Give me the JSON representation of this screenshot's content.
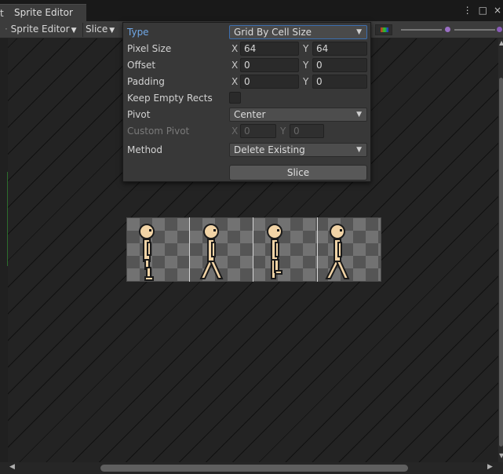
{
  "window": {
    "tab_clip_char": "t",
    "tab_title": "Sprite Editor",
    "controls": [
      "⋮",
      "□",
      "×"
    ]
  },
  "toolbar": {
    "editor_mode": "Sprite Editor",
    "slice_menu": "Slice"
  },
  "slice_popup": {
    "type_label": "Type",
    "type_value": "Grid By Cell Size",
    "pixel_size_label": "Pixel Size",
    "pixel_size": {
      "x_label": "X",
      "x": "64",
      "y_label": "Y",
      "y": "64"
    },
    "offset_label": "Offset",
    "offset": {
      "x_label": "X",
      "x": "0",
      "y_label": "Y",
      "y": "0"
    },
    "padding_label": "Padding",
    "padding": {
      "x_label": "X",
      "x": "0",
      "y_label": "Y",
      "y": "0"
    },
    "keep_empty_label": "Keep Empty Rects",
    "keep_empty_checked": false,
    "pivot_label": "Pivot",
    "pivot_value": "Center",
    "custom_pivot_label": "Custom Pivot",
    "custom_pivot": {
      "x_label": "X",
      "x": "0",
      "y_label": "Y",
      "y": "0"
    },
    "method_label": "Method",
    "method_value": "Delete Existing",
    "slice_button": "Slice"
  },
  "sprite_sheet": {
    "frames": 4,
    "skin_color": "#f2d4a6",
    "outline_color": "#1a1a1a"
  },
  "colors": {
    "accent": "#6fa7e6",
    "panel": "#383838",
    "toolbar": "#3c3c3c",
    "canvas": "#232323"
  }
}
